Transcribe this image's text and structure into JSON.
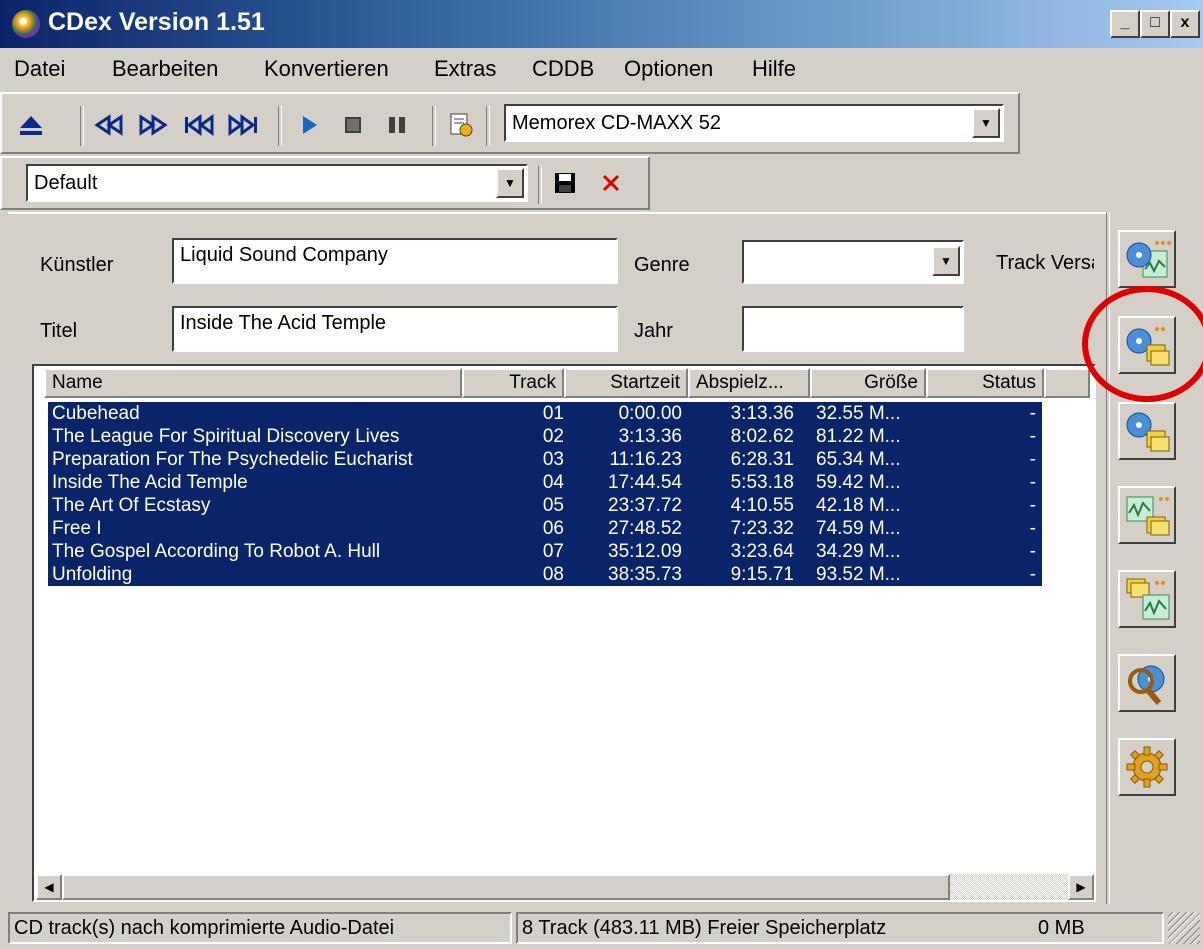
{
  "window": {
    "title": "CDex Version 1.51",
    "minimize_label": "_",
    "maximize_label": "□",
    "close_label": "x"
  },
  "menu": {
    "items": [
      "Datei",
      "Bearbeiten",
      "Konvertieren",
      "Extras",
      "CDDB",
      "Optionen",
      "Hilfe"
    ]
  },
  "toolbar": {
    "drive": "Memorex CD-MAXX 52",
    "profile": "Default"
  },
  "form": {
    "artist_label": "Künstler",
    "artist_value": "Liquid Sound Company",
    "title_label": "Titel",
    "title_value": "Inside The Acid Temple",
    "genre_label": "Genre",
    "genre_value": "",
    "year_label": "Jahr",
    "year_value": "",
    "track_versatz_label": "Track Versa"
  },
  "table": {
    "columns": [
      "Name",
      "Track",
      "Startzeit",
      "Abspielz...",
      "Größe",
      "Status"
    ],
    "rows": [
      {
        "name": "Cubehead",
        "track": "01",
        "start": "0:00.00",
        "play": "3:13.36",
        "size": "32.55 M...",
        "status": "-"
      },
      {
        "name": "The League For Spiritual Discovery Lives",
        "track": "02",
        "start": "3:13.36",
        "play": "8:02.62",
        "size": "81.22 M...",
        "status": "-"
      },
      {
        "name": "Preparation For The Psychedelic Eucharist",
        "track": "03",
        "start": "11:16.23",
        "play": "6:28.31",
        "size": "65.34 M...",
        "status": "-"
      },
      {
        "name": "Inside The Acid Temple",
        "track": "04",
        "start": "17:44.54",
        "play": "5:53.18",
        "size": "59.42 M...",
        "status": "-"
      },
      {
        "name": "The Art Of Ecstasy",
        "track": "05",
        "start": "23:37.72",
        "play": "4:10.55",
        "size": "42.18 M...",
        "status": "-"
      },
      {
        "name": "Free I",
        "track": "06",
        "start": "27:48.52",
        "play": "7:23.32",
        "size": "74.59 M...",
        "status": "-"
      },
      {
        "name": "The Gospel According To Robot A. Hull",
        "track": "07",
        "start": "35:12.09",
        "play": "3:23.64",
        "size": "34.29 M...",
        "status": "-"
      },
      {
        "name": "Unfolding",
        "track": "08",
        "start": "38:35.73",
        "play": "9:15.71",
        "size": "93.52 M...",
        "status": "-"
      }
    ]
  },
  "statusbar": {
    "hint": "CD track(s) nach komprimierte Audio-Datei",
    "summary": "8 Track (483.11 MB) Freier Speicherplatz",
    "free": "0 MB"
  },
  "colors": {
    "selection": "#0a246a",
    "highlight_circle": "#e00000"
  }
}
